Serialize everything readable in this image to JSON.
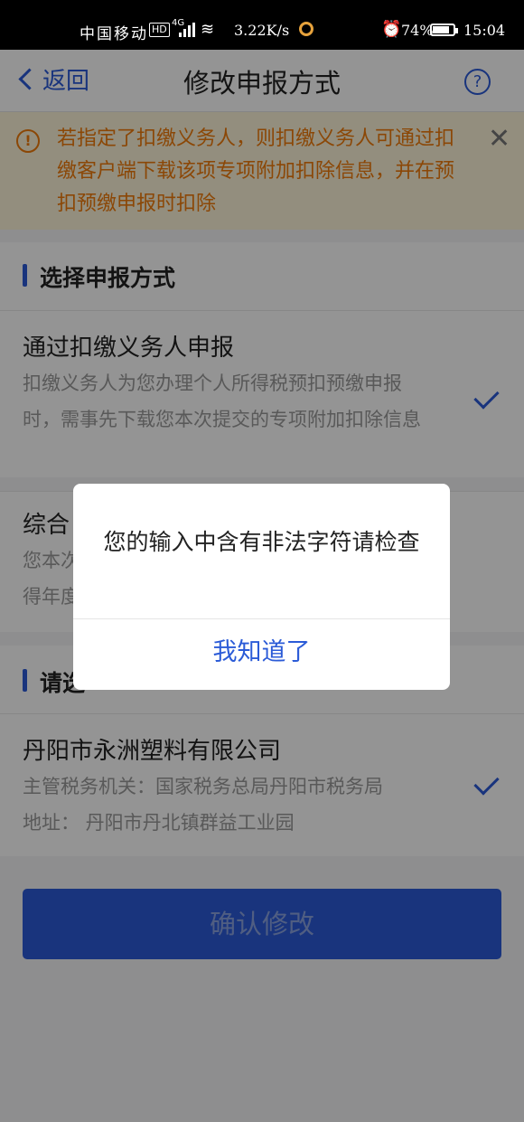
{
  "status_bar": {
    "carrier": "中国移动",
    "hd": "HD",
    "network": "4G",
    "speed": "3.22K/s",
    "battery": "74%",
    "time": "15:04"
  },
  "nav": {
    "back_label": "返回",
    "title": "修改申报方式",
    "help_icon": "?"
  },
  "notice": {
    "icon": "!",
    "text": "若指定了扣缴义务人，则扣缴义务人可通过扣缴客户端下载该项专项附加扣除信息，并在预扣预缴申报时扣除",
    "close_icon": "✕"
  },
  "section": {
    "title": "选择申报方式"
  },
  "options": [
    {
      "title": "通过扣缴义务人申报",
      "desc": "扣缴义务人为您办理个人所得税预扣预缴申报时，需事先下载您本次提交的专项附加扣除信息",
      "selected": true
    },
    {
      "title": "综合",
      "desc_line1": "您本次",
      "desc_line2": "得年度",
      "selected": false
    }
  ],
  "unit_section": {
    "title": "请选"
  },
  "employer": {
    "name": "丹阳市永洲塑料有限公司",
    "tax_office": "主管税务机关：国家税务总局丹阳市税务局",
    "address": "地址： 丹阳市丹北镇群益工业园",
    "selected": true
  },
  "confirm_label": "确认修改",
  "dialog": {
    "message": "您的输入中含有非法字符请检查",
    "button": "我知道了"
  },
  "colors": {
    "accent": "#2b5bd7",
    "warning_text": "#ef7b0b",
    "warning_bg": "#fdf5d9"
  }
}
